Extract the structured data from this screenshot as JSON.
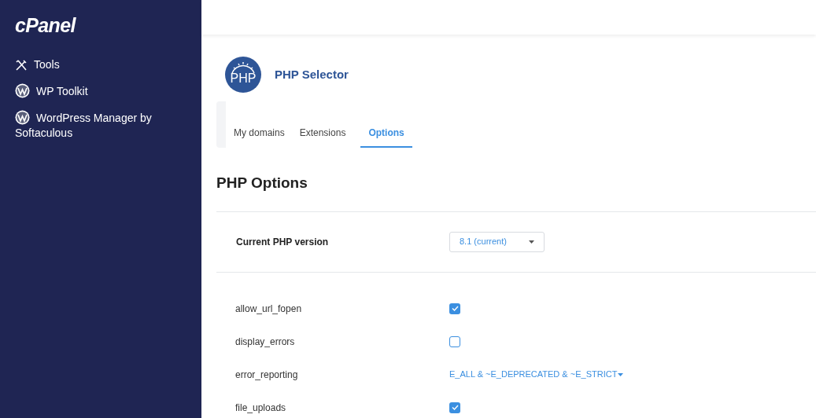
{
  "sidebar": {
    "logo": "cPanel",
    "items": [
      {
        "label": "Tools",
        "kind": "tools"
      },
      {
        "label": "WP Toolkit",
        "kind": "wordpress"
      },
      {
        "label": "WordPress Manager by Softaculous",
        "kind": "wordpress"
      }
    ]
  },
  "header": {
    "title": "PHP Selector",
    "icon_text": "PHP"
  },
  "tabs": [
    {
      "label": "My domains",
      "selected": false
    },
    {
      "label": "Extensions",
      "selected": false
    },
    {
      "label": "Options",
      "selected": true
    }
  ],
  "section_title": "PHP Options",
  "version": {
    "label": "Current PHP version",
    "value": "8.1 (current)"
  },
  "options": [
    {
      "name": "allow_url_fopen",
      "kind": "checkbox",
      "checked": true
    },
    {
      "name": "display_errors",
      "kind": "checkbox",
      "checked": false
    },
    {
      "name": "error_reporting",
      "kind": "select",
      "value": "E_ALL & ~E_DEPRECATED & ~E_STRICT"
    },
    {
      "name": "file_uploads",
      "kind": "checkbox",
      "checked": true
    }
  ]
}
